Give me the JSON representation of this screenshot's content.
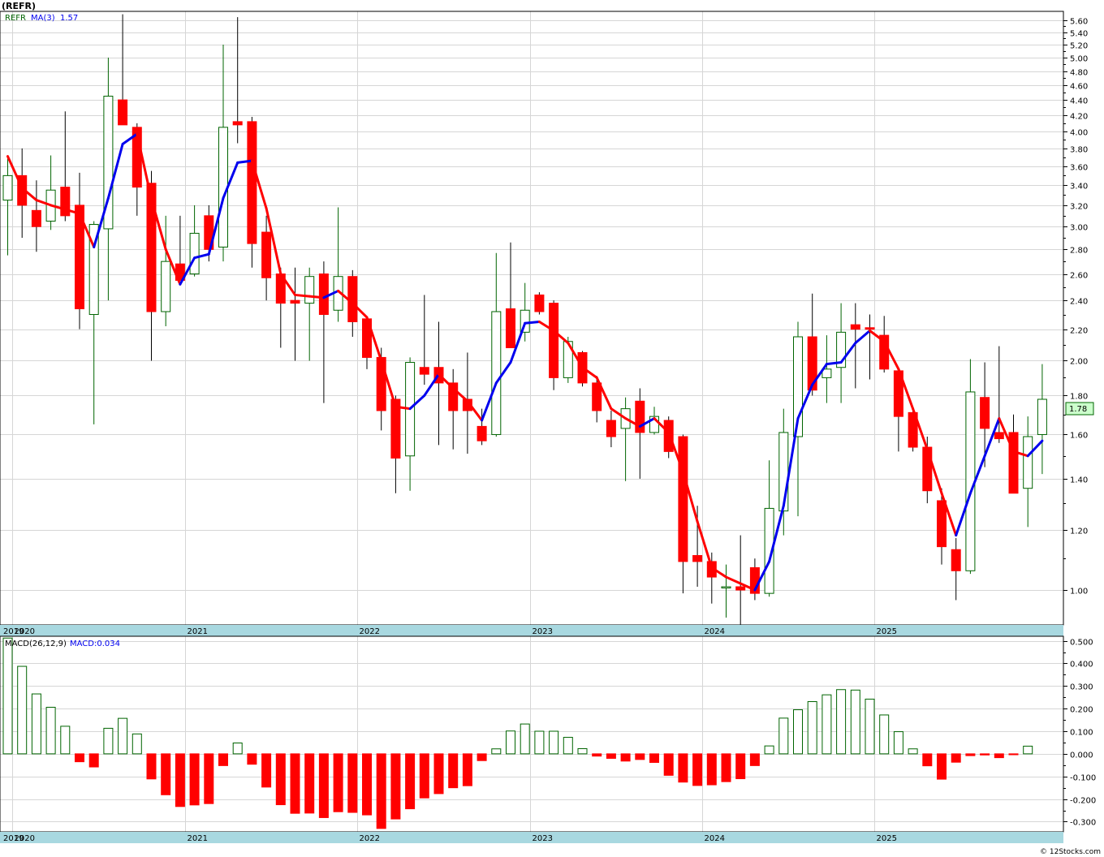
{
  "ticker_title": "(REFR)",
  "legend": {
    "symbol": "REFR",
    "ma_label": "MA(3)",
    "ma_value": "1.57",
    "macd_label": "MACD(26,12,9)",
    "macd_value_label": "MACD:0.034"
  },
  "last_price_label": "1.78",
  "watermark": "© 12Stocks.com",
  "colors": {
    "up_candle": "#006400",
    "down_candle": "#ff0000",
    "ma_up": "#0000ee",
    "ma_down": "#ff0000",
    "axis_band": "#a8d8e0",
    "price_tag_fill": "#ccffcc"
  },
  "chart_data": [
    {
      "type": "candlestick",
      "interval": "monthly",
      "y_scale": "log",
      "y_ticks": [
        1.0,
        1.2,
        1.4,
        1.6,
        1.8,
        2.0,
        2.2,
        2.4,
        2.6,
        2.8,
        3.0,
        3.2,
        3.4,
        3.6,
        3.8,
        4.0,
        4.2,
        4.4,
        4.6,
        4.8,
        5.0,
        5.2,
        5.4,
        5.6
      ],
      "y_range": [
        0.9,
        5.75
      ],
      "x_year_labels": [
        "2019",
        "2020",
        "2021",
        "2022",
        "2023",
        "2024",
        "2025"
      ],
      "grid": true,
      "candles": [
        {
          "o": 3.25,
          "h": 3.7,
          "l": 2.75,
          "c": 3.5
        },
        {
          "o": 3.5,
          "h": 3.8,
          "l": 2.9,
          "c": 3.2
        },
        {
          "o": 3.15,
          "h": 3.45,
          "l": 2.78,
          "c": 3.0
        },
        {
          "o": 3.05,
          "h": 3.72,
          "l": 2.97,
          "c": 3.35
        },
        {
          "o": 3.38,
          "h": 4.25,
          "l": 3.05,
          "c": 3.1
        },
        {
          "o": 3.2,
          "h": 3.53,
          "l": 2.2,
          "c": 2.34
        },
        {
          "o": 2.3,
          "h": 3.05,
          "l": 1.65,
          "c": 3.02
        },
        {
          "o": 2.98,
          "h": 5.0,
          "l": 2.4,
          "c": 4.45
        },
        {
          "o": 4.4,
          "h": 5.7,
          "l": 4.2,
          "c": 4.08
        },
        {
          "o": 4.05,
          "h": 4.1,
          "l": 3.1,
          "c": 3.38
        },
        {
          "o": 3.42,
          "h": 3.55,
          "l": 2.0,
          "c": 2.32
        },
        {
          "o": 2.32,
          "h": 3.1,
          "l": 2.22,
          "c": 2.7
        },
        {
          "o": 2.68,
          "h": 3.1,
          "l": 2.55,
          "c": 2.55
        },
        {
          "o": 2.6,
          "h": 3.2,
          "l": 2.58,
          "c": 2.94
        },
        {
          "o": 3.1,
          "h": 3.2,
          "l": 2.7,
          "c": 2.8
        },
        {
          "o": 2.82,
          "h": 5.2,
          "l": 2.7,
          "c": 4.05
        },
        {
          "o": 4.12,
          "h": 5.65,
          "l": 3.86,
          "c": 4.08
        },
        {
          "o": 4.12,
          "h": 4.18,
          "l": 2.65,
          "c": 2.85
        },
        {
          "o": 2.95,
          "h": 3.1,
          "l": 2.4,
          "c": 2.57
        },
        {
          "o": 2.6,
          "h": 2.65,
          "l": 2.08,
          "c": 2.38
        },
        {
          "o": 2.4,
          "h": 2.65,
          "l": 2.0,
          "c": 2.38
        },
        {
          "o": 2.38,
          "h": 2.65,
          "l": 2.0,
          "c": 2.58
        },
        {
          "o": 2.6,
          "h": 2.7,
          "l": 1.76,
          "c": 2.3
        },
        {
          "o": 2.33,
          "h": 3.18,
          "l": 2.25,
          "c": 2.58
        },
        {
          "o": 2.58,
          "h": 2.63,
          "l": 2.15,
          "c": 2.25
        },
        {
          "o": 2.27,
          "h": 2.28,
          "l": 1.95,
          "c": 2.02
        },
        {
          "o": 2.02,
          "h": 2.08,
          "l": 1.62,
          "c": 1.72
        },
        {
          "o": 1.78,
          "h": 1.8,
          "l": 1.34,
          "c": 1.49
        },
        {
          "o": 1.5,
          "h": 2.02,
          "l": 1.35,
          "c": 1.99
        },
        {
          "o": 1.96,
          "h": 2.44,
          "l": 1.86,
          "c": 1.92
        },
        {
          "o": 1.96,
          "h": 2.25,
          "l": 1.55,
          "c": 1.87
        },
        {
          "o": 1.87,
          "h": 1.95,
          "l": 1.53,
          "c": 1.72
        },
        {
          "o": 1.78,
          "h": 2.05,
          "l": 1.51,
          "c": 1.72
        },
        {
          "o": 1.64,
          "h": 1.73,
          "l": 1.55,
          "c": 1.57
        },
        {
          "o": 1.6,
          "h": 2.77,
          "l": 1.59,
          "c": 2.32
        },
        {
          "o": 2.34,
          "h": 2.86,
          "l": 2.08,
          "c": 2.08
        },
        {
          "o": 2.18,
          "h": 2.53,
          "l": 2.12,
          "c": 2.33
        },
        {
          "o": 2.44,
          "h": 2.46,
          "l": 2.3,
          "c": 2.32
        },
        {
          "o": 2.38,
          "h": 2.4,
          "l": 1.83,
          "c": 1.9
        },
        {
          "o": 1.9,
          "h": 2.15,
          "l": 1.87,
          "c": 2.12
        },
        {
          "o": 2.05,
          "h": 2.06,
          "l": 1.85,
          "c": 1.87
        },
        {
          "o": 1.87,
          "h": 1.91,
          "l": 1.66,
          "c": 1.72
        },
        {
          "o": 1.67,
          "h": 1.72,
          "l": 1.54,
          "c": 1.59
        },
        {
          "o": 1.63,
          "h": 1.79,
          "l": 1.39,
          "c": 1.73
        },
        {
          "o": 1.77,
          "h": 1.84,
          "l": 1.4,
          "c": 1.61
        },
        {
          "o": 1.61,
          "h": 1.74,
          "l": 1.6,
          "c": 1.69
        },
        {
          "o": 1.67,
          "h": 1.69,
          "l": 1.49,
          "c": 1.52
        },
        {
          "o": 1.59,
          "h": 1.6,
          "l": 0.99,
          "c": 1.09
        },
        {
          "o": 1.11,
          "h": 1.29,
          "l": 1.01,
          "c": 1.09
        },
        {
          "o": 1.09,
          "h": 1.12,
          "l": 0.96,
          "c": 1.04
        },
        {
          "o": 1.01,
          "h": 1.08,
          "l": 0.92,
          "c": 1.01
        },
        {
          "o": 1.01,
          "h": 1.18,
          "l": 0.9,
          "c": 1.0
        },
        {
          "o": 1.07,
          "h": 1.1,
          "l": 0.97,
          "c": 0.99
        },
        {
          "o": 0.99,
          "h": 1.48,
          "l": 0.98,
          "c": 1.28
        },
        {
          "o": 1.27,
          "h": 1.73,
          "l": 1.18,
          "c": 1.61
        },
        {
          "o": 1.59,
          "h": 2.25,
          "l": 1.25,
          "c": 2.15
        },
        {
          "o": 2.15,
          "h": 2.45,
          "l": 1.8,
          "c": 1.83
        },
        {
          "o": 1.9,
          "h": 2.16,
          "l": 1.76,
          "c": 1.95
        },
        {
          "o": 1.96,
          "h": 2.38,
          "l": 1.76,
          "c": 2.18
        },
        {
          "o": 2.23,
          "h": 2.38,
          "l": 1.84,
          "c": 2.2
        },
        {
          "o": 2.21,
          "h": 2.3,
          "l": 1.89,
          "c": 2.2
        },
        {
          "o": 2.16,
          "h": 2.29,
          "l": 1.93,
          "c": 1.95
        },
        {
          "o": 1.94,
          "h": 1.96,
          "l": 1.52,
          "c": 1.69
        },
        {
          "o": 1.71,
          "h": 1.74,
          "l": 1.52,
          "c": 1.54
        },
        {
          "o": 1.54,
          "h": 1.59,
          "l": 1.3,
          "c": 1.35
        },
        {
          "o": 1.31,
          "h": 1.36,
          "l": 1.08,
          "c": 1.14
        },
        {
          "o": 1.13,
          "h": 1.17,
          "l": 0.97,
          "c": 1.06
        },
        {
          "o": 1.06,
          "h": 2.01,
          "l": 1.05,
          "c": 1.82
        },
        {
          "o": 1.79,
          "h": 1.99,
          "l": 1.45,
          "c": 1.63
        },
        {
          "o": 1.61,
          "h": 2.09,
          "l": 1.56,
          "c": 1.58
        },
        {
          "o": 1.61,
          "h": 1.7,
          "l": 1.34,
          "c": 1.34
        },
        {
          "o": 1.36,
          "h": 1.69,
          "l": 1.21,
          "c": 1.59
        },
        {
          "o": 1.6,
          "h": 1.98,
          "l": 1.42,
          "c": 1.78
        }
      ],
      "ma3": [
        3.71,
        3.37,
        3.25,
        3.2,
        3.16,
        3.12,
        2.82,
        3.27,
        3.85,
        3.97,
        3.26,
        2.8,
        2.52,
        2.73,
        2.76,
        3.27,
        3.64,
        3.66,
        3.17,
        2.6,
        2.44,
        2.43,
        2.42,
        2.47,
        2.38,
        2.28,
        2.0,
        1.74,
        1.73,
        1.8,
        1.92,
        1.84,
        1.77,
        1.67,
        1.87,
        1.99,
        2.24,
        2.25,
        2.19,
        2.11,
        1.96,
        1.9,
        1.73,
        1.68,
        1.64,
        1.68,
        1.61,
        1.43,
        1.23,
        1.07,
        1.04,
        1.02,
        1.0,
        1.09,
        1.29,
        1.68,
        1.86,
        1.98,
        1.99,
        2.11,
        2.19,
        2.12,
        1.95,
        1.73,
        1.53,
        1.34,
        1.18,
        1.34,
        1.5,
        1.68,
        1.52,
        1.5,
        1.57
      ]
    },
    {
      "type": "histogram",
      "name": "MACD",
      "y_ticks": [
        -0.3,
        -0.2,
        -0.1,
        0.0,
        0.1,
        0.2,
        0.3,
        0.4,
        0.5
      ],
      "y_tick_labels": [
        "-0.300",
        "-0.200",
        "-0.100",
        "0.000",
        "0.100",
        "0.200",
        "0.300",
        "0.400",
        "0.500"
      ],
      "y_range": [
        -0.345,
        0.52
      ],
      "x_year_labels": [
        "2019",
        "2020",
        "2021",
        "2022",
        "2023",
        "2024",
        "2025"
      ],
      "values": [
        0.512,
        0.387,
        0.265,
        0.206,
        0.122,
        -0.035,
        -0.058,
        0.113,
        0.157,
        0.088,
        -0.111,
        -0.181,
        -0.233,
        -0.226,
        -0.22,
        -0.052,
        0.048,
        -0.046,
        -0.147,
        -0.225,
        -0.263,
        -0.262,
        -0.282,
        -0.256,
        -0.259,
        -0.27,
        -0.33,
        -0.288,
        -0.243,
        -0.195,
        -0.176,
        -0.15,
        -0.141,
        -0.03,
        0.022,
        0.101,
        0.132,
        0.1,
        0.1,
        0.073,
        0.023,
        -0.01,
        -0.02,
        -0.032,
        -0.025,
        -0.038,
        -0.095,
        -0.125,
        -0.14,
        -0.137,
        -0.123,
        -0.11,
        -0.052,
        0.035,
        0.158,
        0.195,
        0.231,
        0.261,
        0.284,
        0.282,
        0.242,
        0.172,
        0.098,
        0.022,
        -0.053,
        -0.112,
        -0.037,
        -0.008,
        -0.005,
        -0.017,
        -0.004,
        0.034
      ]
    }
  ]
}
